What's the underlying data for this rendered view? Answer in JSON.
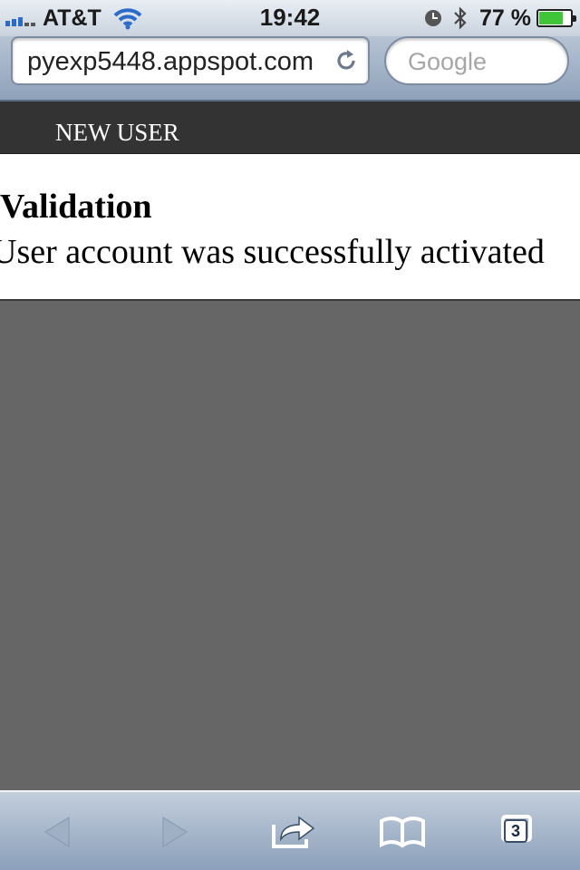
{
  "status_bar": {
    "carrier": "AT&T",
    "time": "19:42",
    "battery_percent": "77 %",
    "battery_level": 0.77,
    "icons": [
      "signal-icon",
      "wifi-icon",
      "clock-icon",
      "bluetooth-icon",
      "battery-icon"
    ]
  },
  "browser": {
    "url": "pyexp5448.appspot.com",
    "search_placeholder": "Google",
    "tabs_count": "3",
    "toolbar_icons": [
      "back-icon",
      "forward-icon",
      "share-icon",
      "bookmarks-icon",
      "tabs-icon"
    ]
  },
  "page": {
    "header_title": "NEW USER",
    "title": "Validation",
    "message": "User account was successfully activated"
  },
  "colors": {
    "header_bg": "#333333",
    "page_bg": "#666666",
    "battery_fill": "#3fc43a",
    "signal": "#2c6bc7"
  }
}
